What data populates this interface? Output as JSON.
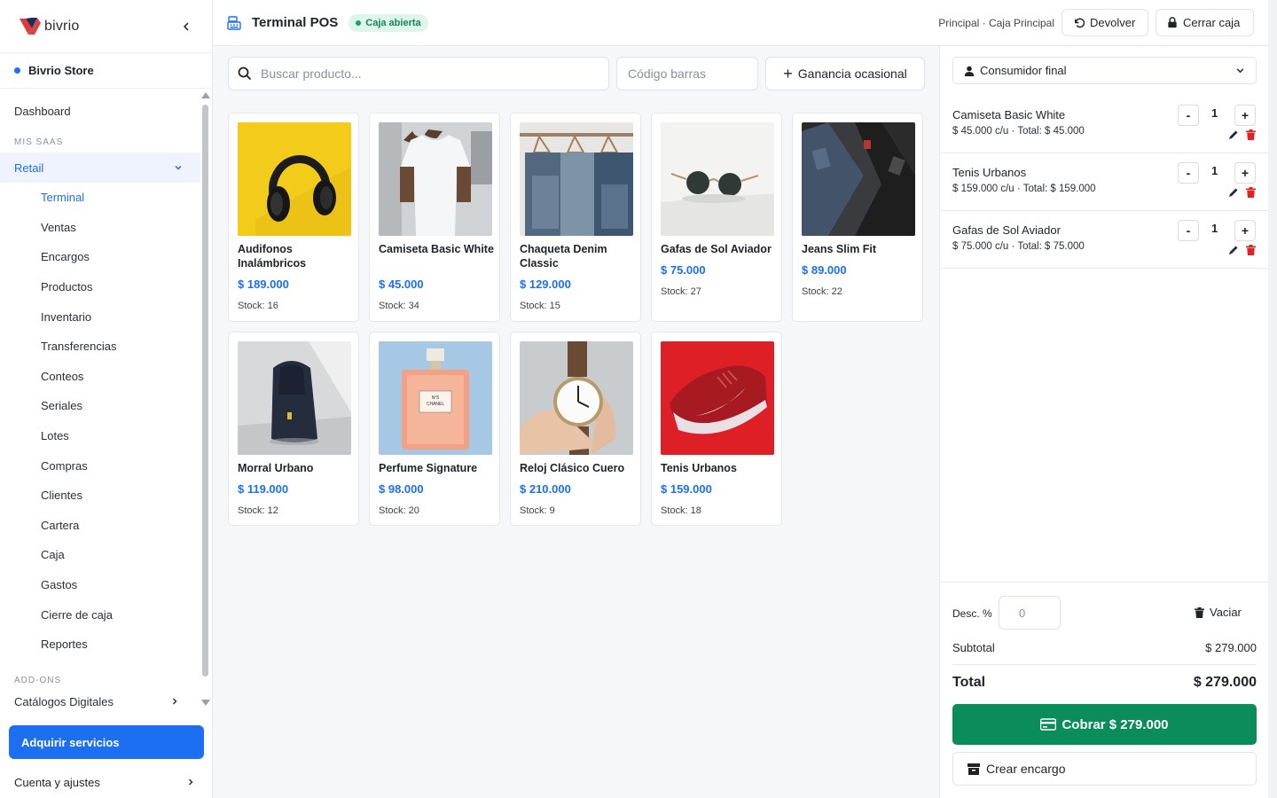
{
  "sidebar": {
    "brand": "bivrio",
    "store": "Bivrio Store",
    "dashboard": "Dashboard",
    "section_saas": "MIS SAAS",
    "retail": "Retail",
    "sub_items": [
      "Terminal",
      "Ventas",
      "Encargos",
      "Productos",
      "Inventario",
      "Transferencias",
      "Conteos",
      "Seriales",
      "Lotes",
      "Compras",
      "Clientes",
      "Cartera",
      "Caja",
      "Gastos",
      "Cierre de caja",
      "Reportes"
    ],
    "section_addons": "ADD-ONS",
    "catalogos": "Catálogos Digitales",
    "cta": "Adquirir servicios",
    "account": "Cuenta y ajustes"
  },
  "header": {
    "title": "Terminal POS",
    "badge": "Caja abierta",
    "breadcrumb": "Principal · Caja Principal",
    "devolver": "Devolver",
    "cerrar": "Cerrar caja"
  },
  "main": {
    "search_placeholder": "Buscar producto...",
    "barcode_placeholder": "Código barras",
    "ocasional": "Ganancia ocasional",
    "products": [
      {
        "name": "Audifonos Inalámbricos",
        "price": "$ 189.000",
        "stock": "Stock: 16"
      },
      {
        "name": "Camiseta Basic White",
        "price": "$ 45.000",
        "stock": "Stock: 34"
      },
      {
        "name": "Chaqueta Denim Classic",
        "price": "$ 129.000",
        "stock": "Stock: 15"
      },
      {
        "name": "Gafas de Sol Aviador",
        "price": "$ 75.000",
        "stock": "Stock: 27"
      },
      {
        "name": "Jeans Slim Fit",
        "price": "$ 89.000",
        "stock": "Stock: 22"
      },
      {
        "name": "Morral Urbano",
        "price": "$ 119.000",
        "stock": "Stock: 12"
      },
      {
        "name": "Perfume Signature",
        "price": "$ 98.000",
        "stock": "Stock: 20"
      },
      {
        "name": "Reloj Clásico Cuero",
        "price": "$ 210.000",
        "stock": "Stock: 9"
      },
      {
        "name": "Tenis Urbanos",
        "price": "$ 159.000",
        "stock": "Stock: 18"
      }
    ]
  },
  "cart": {
    "customer": "Consumidor final",
    "lines": [
      {
        "name": "Camiseta Basic White",
        "detail": "$ 45.000 c/u · Total: $ 45.000",
        "qty": "1"
      },
      {
        "name": "Tenis Urbanos",
        "detail": "$ 159.000 c/u · Total: $ 159.000",
        "qty": "1"
      },
      {
        "name": "Gafas de Sol Aviador",
        "detail": "$ 75.000 c/u · Total: $ 75.000",
        "qty": "1"
      }
    ],
    "minus": "-",
    "plus": "+",
    "desc_label": "Desc. %",
    "desc_value": "0",
    "vaciar": "Vaciar",
    "subtotal_label": "Subtotal",
    "subtotal_value": "$ 279.000",
    "total_label": "Total",
    "total_value": "$ 279.000",
    "cobrar": "Cobrar $ 279.000",
    "encargo": "Crear encargo"
  },
  "colors": {
    "accent": "#1d6ff2",
    "success": "#0b8d5b",
    "danger": "#e02424"
  }
}
